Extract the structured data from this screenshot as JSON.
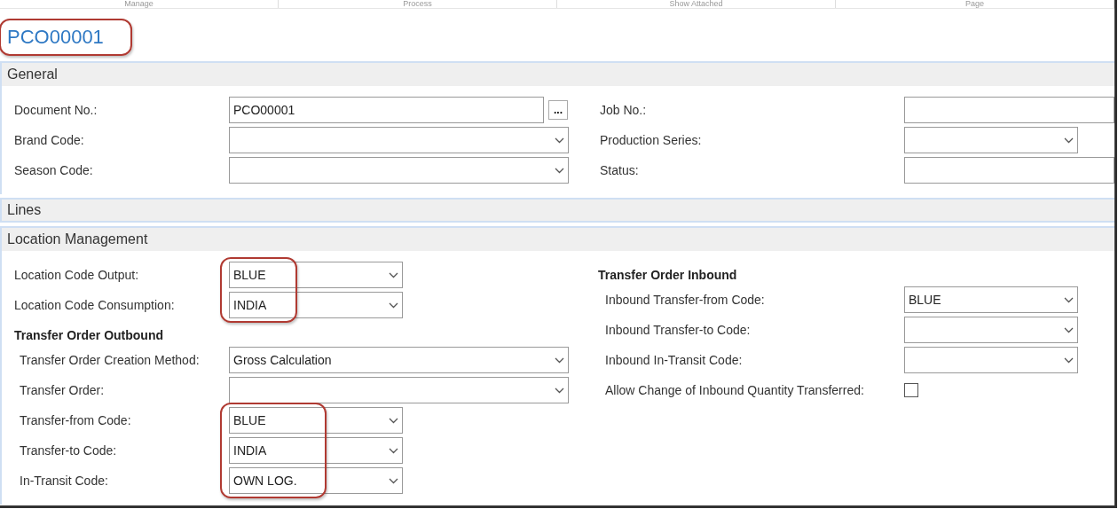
{
  "ribbon": [
    {
      "label": "Manage"
    },
    {
      "label": "Process"
    },
    {
      "label": "Show Attached"
    },
    {
      "label": "Page"
    }
  ],
  "title": {
    "text": "PCO00001",
    "circled": true
  },
  "sections": [
    {
      "title": "General",
      "expanded": true,
      "columns": [
        [
          {
            "fields": [
              {
                "label": "Document No.:",
                "kind": "lookup",
                "value": "PCO00001",
                "button": "...",
                "circled": false
              },
              {
                "label": "Brand Code:",
                "kind": "dropdown",
                "circled": false
              },
              {
                "label": "Season Code:",
                "kind": "dropdown",
                "circled": false
              }
            ]
          }
        ],
        [
          {
            "fields": [
              {
                "label": "Job No.:",
                "kind": "text",
                "circled": false
              },
              {
                "label": "Production Series:",
                "kind": "dropdown",
                "circled": false
              },
              {
                "label": "Status:",
                "kind": "text",
                "circled": false
              }
            ]
          }
        ]
      ]
    },
    {
      "title": "Lines",
      "expanded": false
    },
    {
      "title": "Location Management",
      "expanded": true,
      "columns": [
        [
          {
            "fields": [
              {
                "label": "Location Code Output:",
                "kind": "dropdown",
                "value": "BLUE",
                "circled": true
              },
              {
                "label": "Location Code Consumption:",
                "kind": "dropdown",
                "value": "INDIA",
                "circled": true
              }
            ]
          },
          {
            "heading": "Transfer Order Outbound",
            "fields": [
              {
                "label": "Transfer Order Creation Method:",
                "kind": "dropdown",
                "value": "Gross Calculation",
                "circled": false
              },
              {
                "label": "Transfer Order:",
                "kind": "dropdown",
                "circled": false
              },
              {
                "label": "Transfer-from Code:",
                "kind": "dropdown",
                "value": "BLUE",
                "circled": true
              },
              {
                "label": "Transfer-to Code:",
                "kind": "dropdown",
                "value": "INDIA",
                "circled": true
              },
              {
                "label": "In-Transit Code:",
                "kind": "dropdown",
                "value": "OWN LOG.",
                "circled": true
              }
            ]
          }
        ],
        [
          {
            "heading": "Transfer Order Inbound",
            "fields": [
              {
                "label": "Inbound Transfer-from Code:",
                "kind": "dropdown",
                "value": "BLUE",
                "circled": false
              },
              {
                "label": "Inbound Transfer-to Code:",
                "kind": "dropdown",
                "circled": false
              },
              {
                "label": "Inbound In-Transit Code:",
                "kind": "dropdown",
                "circled": false
              },
              {
                "label": "Allow Change of Inbound Quantity Transferred:",
                "kind": "checkbox",
                "checked": false,
                "circled": false
              }
            ]
          }
        ]
      ]
    }
  ]
}
